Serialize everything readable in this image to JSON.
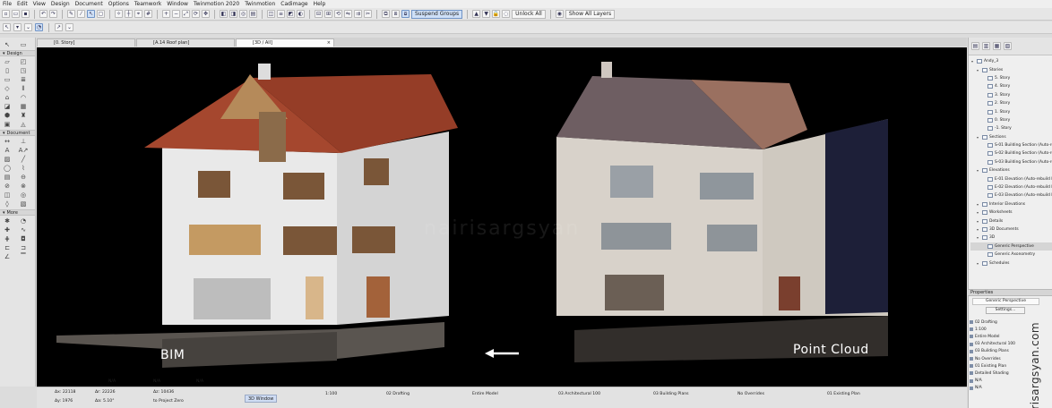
{
  "menu": [
    "File",
    "Edit",
    "View",
    "Design",
    "Document",
    "Options",
    "Teamwork",
    "Window",
    "Twinmotion 2020",
    "Twinmotion",
    "Cadimage",
    "Help"
  ],
  "toolbar": {
    "suspend_groups": "Suspend Groups",
    "unlock_all": "Unlock All",
    "show_all_layers": "Show All Layers"
  },
  "toolbox": {
    "sections": [
      "Design",
      "Document",
      "More"
    ]
  },
  "tabs": [
    {
      "label": "[0. Story]"
    },
    {
      "label": "[A.14 Roof plan]"
    },
    {
      "label": "[3D / All]"
    }
  ],
  "viewport": {
    "left_label": "BIM",
    "right_label": "Point Cloud",
    "watermark": "nairisargsyan"
  },
  "navigator": {
    "items": [
      {
        "label": "Andy_3",
        "level": 0
      },
      {
        "label": "Stories",
        "level": 1
      },
      {
        "label": "5. Story",
        "level": 2
      },
      {
        "label": "4. Story",
        "level": 2
      },
      {
        "label": "3. Story",
        "level": 2
      },
      {
        "label": "2. Story",
        "level": 2
      },
      {
        "label": "1. Story",
        "level": 2
      },
      {
        "label": "0. Story",
        "level": 2
      },
      {
        "label": "-1. Story",
        "level": 2
      },
      {
        "label": "Sections",
        "level": 1
      },
      {
        "label": "S-01 Building Section (Auto-re",
        "level": 2
      },
      {
        "label": "S-02 Building Section (Auto-re",
        "level": 2
      },
      {
        "label": "S-03 Building Section (Auto-re",
        "level": 2
      },
      {
        "label": "Elevations",
        "level": 1
      },
      {
        "label": "E-01 Elevation (Auto-rebuild M",
        "level": 2
      },
      {
        "label": "E-02 Elevation (Auto-rebuild M",
        "level": 2
      },
      {
        "label": "E-03 Elevation (Auto-rebuild M",
        "level": 2
      },
      {
        "label": "Interior Elevations",
        "level": 1
      },
      {
        "label": "Worksheets",
        "level": 1
      },
      {
        "label": "Details",
        "level": 1
      },
      {
        "label": "3D Documents",
        "level": 1
      },
      {
        "label": "3D",
        "level": 1
      },
      {
        "label": "Generic Perspective",
        "level": 2,
        "selected": true
      },
      {
        "label": "Generic Axonometry",
        "level": 2
      },
      {
        "label": "Schedules",
        "level": 1
      }
    ]
  },
  "properties": {
    "header": "Properties",
    "name": "Generic Perspective",
    "settings": "Settings...",
    "rows": [
      "02 Drafting",
      "1:100",
      "Entire Model",
      "03 Architectural 100",
      "03 Building Plans",
      "No Overrides",
      "01 Existing Plan",
      "Detailed Shading",
      "N/A",
      "N/A"
    ]
  },
  "side_watermark": "nairisargsyan.com",
  "statusbar": {
    "coord1": "Δx: 22118",
    "coord2": "Δy: 1976",
    "coord3": "Δr: 22226",
    "coord4": "Δa: 5.10°",
    "coord5": "Δz: 10436",
    "to_zero": "to Project Zero",
    "window_btn": "3D Window",
    "scale": "1:100",
    "layer": "02 Drafting",
    "model": "Entire Model",
    "pen_set": "03 Architectural 100",
    "mvo": "03 Building Plans",
    "overrides": "No Overrides",
    "renovation": "01 Existing Plan",
    "na1": "N/A",
    "na2": "N/A",
    "na3": "N/A"
  }
}
